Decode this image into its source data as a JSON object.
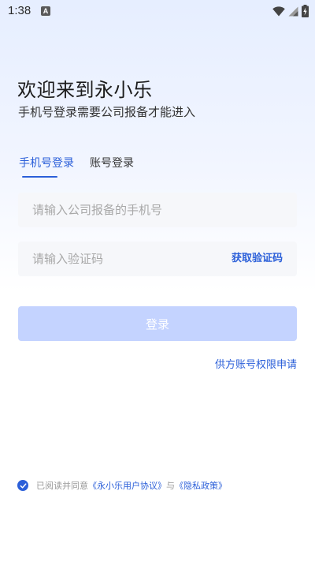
{
  "status_bar": {
    "time": "1:38",
    "notification_badge": "A",
    "icons": [
      "wifi-icon",
      "signal-icon",
      "battery-charging-icon"
    ]
  },
  "welcome": {
    "title": "欢迎来到永小乐",
    "subtitle": "手机号登录需要公司报备才能进入"
  },
  "tabs": {
    "phone_login": "手机号登录",
    "account_login": "账号登录",
    "active": "phone_login"
  },
  "form": {
    "phone_placeholder": "请输入公司报备的手机号",
    "phone_value": "",
    "code_placeholder": "请输入验证码",
    "code_value": "",
    "get_code_label": "获取验证码",
    "login_label": "登录"
  },
  "links": {
    "supplier_apply": "供方账号权限申请"
  },
  "agreement": {
    "checked": true,
    "prefix": "已阅读并同意",
    "user_agreement": "《永小乐用户协议》",
    "connector": "与",
    "privacy_policy": "《隐私政策》"
  },
  "colors": {
    "accent": "#2b5fd9",
    "login_button_disabled": "#c4d3ff",
    "field_background": "#f6f7fa",
    "placeholder": "#a8a8a8"
  }
}
